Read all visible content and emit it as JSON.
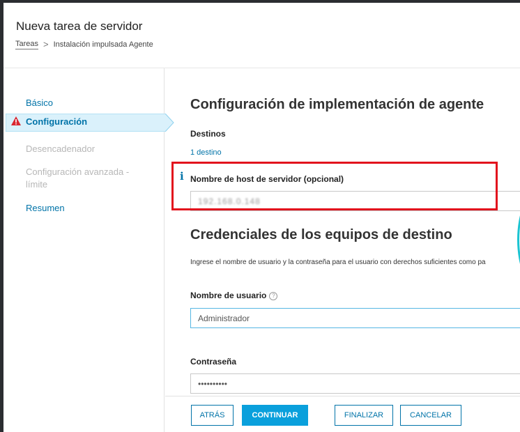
{
  "header": {
    "title": "Nueva tarea de servidor",
    "breadcrumb": {
      "parent": "Tareas",
      "separator": ">",
      "current": "Instalación impulsada Agente"
    }
  },
  "sidebar": {
    "items": [
      {
        "label": "Básico",
        "state": "link"
      },
      {
        "label": "Configuración",
        "state": "active-warning"
      },
      {
        "label": "Desencadenador",
        "state": "disabled"
      },
      {
        "label": "Configuración avanzada -",
        "state": "disabled"
      },
      {
        "label": "límite",
        "state": "disabled"
      },
      {
        "label": "Resumen",
        "state": "link"
      }
    ],
    "warning_icon": "warning-triangle-icon"
  },
  "main": {
    "heading": "Configuración de implementación de agente",
    "targets_label": "Destinos",
    "targets_link": "1 destino",
    "hostname_label": "Nombre de host de servidor (opcional)",
    "hostname_value": "192.168.0.148",
    "info_icon": "i",
    "credentials_heading": "Credenciales de los equipos de destino",
    "credentials_desc": "Ingrese el nombre de usuario y la contraseña para el usuario con derechos suficientes como pa",
    "username_label": "Nombre de usuario",
    "help_icon": "?",
    "username_value": "Administrador",
    "password_label": "Contraseña",
    "password_value": "••••••••••"
  },
  "footer": {
    "back": "ATRÁS",
    "continue": "CONTINUAR",
    "finish": "FINALIZAR",
    "cancel": "CANCELAR"
  },
  "colors": {
    "accent": "#0073a8",
    "primary_button": "#0aa0dc",
    "active_nav_bg": "#daf1fb",
    "warning": "#e2121d",
    "highlight_box": "#e2121d"
  }
}
